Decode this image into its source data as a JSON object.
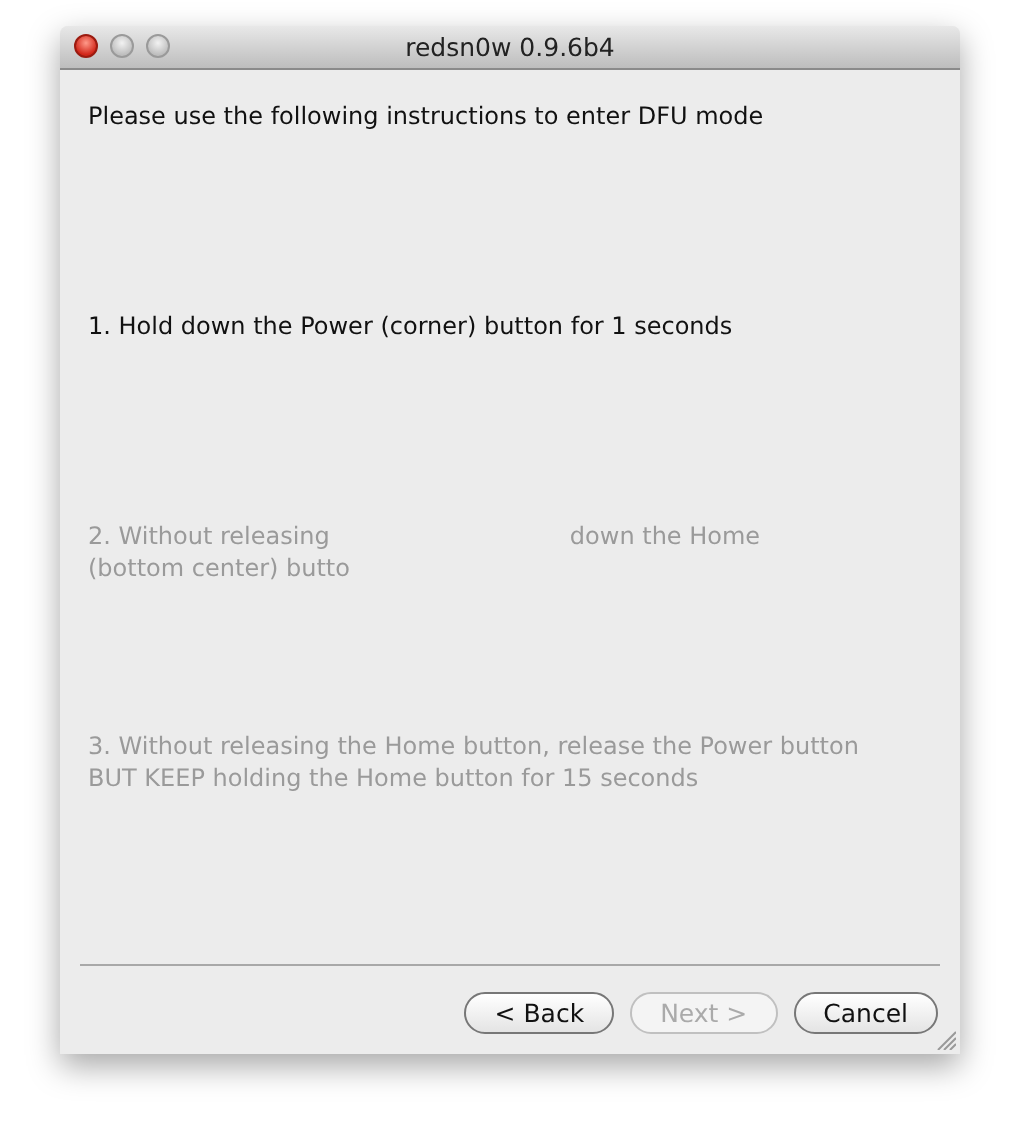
{
  "window": {
    "title": "redsn0w 0.9.6b4"
  },
  "intro": "Please use the following instructions to enter DFU mode",
  "steps": [
    {
      "active": true,
      "lines": [
        [
          "1. Hold down the Power (corner) button for 1 seconds"
        ]
      ]
    },
    {
      "active": false,
      "lines": [
        [
          "2. Without releasing",
          "down the Home"
        ],
        [
          "(bottom center) butto"
        ]
      ]
    },
    {
      "active": false,
      "lines": [
        [
          "3. Without releasing the Home button, release the Power button"
        ],
        [
          "BUT KEEP holding the Home button for 15 seconds"
        ]
      ]
    }
  ],
  "buttons": [
    {
      "label": "< Back",
      "disabled": false
    },
    {
      "label": "Next >",
      "disabled": true
    },
    {
      "label": "Cancel",
      "disabled": false
    }
  ]
}
